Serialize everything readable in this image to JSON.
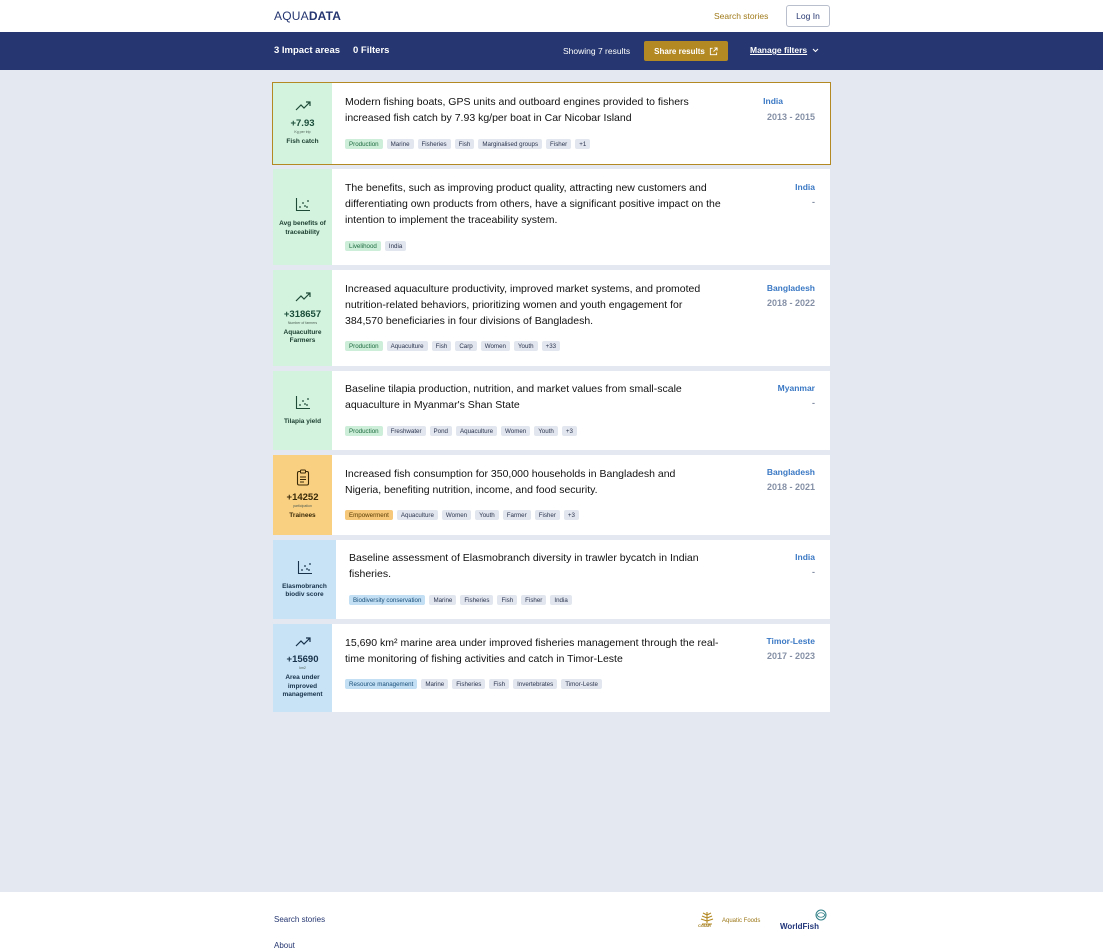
{
  "header": {
    "logo_light": "AQUA",
    "logo_bold": "DATA",
    "search_stories": "Search stories",
    "login": "Log In"
  },
  "filterbar": {
    "impact_areas": "3 Impact areas",
    "filters": "0 Filters",
    "showing": "Showing 7 results",
    "share": "Share results",
    "manage": "Manage filters"
  },
  "cards": [
    {
      "icon": "trend-up-icon",
      "metric_value": "+7.93",
      "metric_unit": "Kg per trip",
      "metric_label": "Fish catch",
      "title": "Modern fishing boats, GPS units and outboard engines provided to fishers increased fish catch by 7.93 kg/per boat in Car Nicobar Island",
      "tags": [
        "Production",
        "Marine",
        "Fisheries",
        "Fish",
        "Marginalised groups",
        "Fisher",
        "+1"
      ],
      "country": "India",
      "years": "2013 - 2015"
    },
    {
      "icon": "scatter-chart-icon",
      "metric_value": "",
      "metric_unit": "",
      "metric_label": "Avg benefits of traceability",
      "title": "The benefits, such as improving product quality, attracting new customers and differentiating own products from others, have a significant positive impact on the intention to implement the traceability system.",
      "tags": [
        "Livelihood",
        "India"
      ],
      "country": "India",
      "years": "-"
    },
    {
      "icon": "trend-up-icon",
      "metric_value": "+318657",
      "metric_unit": "Number of farmers",
      "metric_label": "Aquaculture Farmers",
      "title": "Increased aquaculture productivity, improved market systems, and promoted nutrition-related behaviors, prioritizing women and youth engagement for 384,570 beneficiaries in four divisions of Bangladesh.",
      "tags": [
        "Production",
        "Aquaculture",
        "Fish",
        "Carp",
        "Women",
        "Youth",
        "+33"
      ],
      "country": "Bangladesh",
      "years": "2018 - 2022"
    },
    {
      "icon": "scatter-chart-icon",
      "metric_value": "",
      "metric_unit": "",
      "metric_label": "Tilapia yield",
      "title": "Baseline tilapia production, nutrition, and market values from small-scale aquaculture in Myanmar's Shan State",
      "tags": [
        "Production",
        "Freshwater",
        "Pond",
        "Aquaculture",
        "Women",
        "Youth",
        "+3"
      ],
      "country": "Myanmar",
      "years": "-"
    },
    {
      "icon": "clipboard-icon",
      "metric_value": "+14252",
      "metric_unit": "participation",
      "metric_label": "Trainees",
      "title": "Increased fish consumption for 350,000 households in Bangladesh and Nigeria, benefiting nutrition, income, and food security.",
      "tags": [
        "Empowerment",
        "Aquaculture",
        "Women",
        "Youth",
        "Farmer",
        "Fisher",
        "+3"
      ],
      "country": "Bangladesh",
      "years": "2018 - 2021"
    },
    {
      "icon": "scatter-chart-icon",
      "metric_value": "",
      "metric_unit": "",
      "metric_label": "Elasmobranch biodiv score",
      "title": "Baseline assessment of Elasmobranch diversity in trawler bycatch in Indian fisheries.",
      "tags": [
        "Biodiversity conservation",
        "Marine",
        "Fisheries",
        "Fish",
        "Fisher",
        "India"
      ],
      "country": "India",
      "years": "-"
    },
    {
      "icon": "trend-up-icon",
      "metric_value": "+15690",
      "metric_unit": "km2",
      "metric_label": "Area under improved management",
      "title": "15,690 km² marine area under improved fisheries management through the real-time monitoring of fishing activities and catch in Timor-Leste",
      "tags": [
        "Resource management",
        "Marine",
        "Fisheries",
        "Fish",
        "Invertebrates",
        "Timor-Leste"
      ],
      "country": "Timor-Leste",
      "years": "2017 - 2023"
    }
  ],
  "footer": {
    "search_stories": "Search stories",
    "about": "About",
    "cgiar_small": "CGIAR",
    "cgiar_name": "Aquatic Foods",
    "worldfish": "WorldFish"
  },
  "colors": {
    "navy": "#253670",
    "gold": "#b38924",
    "green_panel": "#d3f3de",
    "orange_panel": "#f9cf82",
    "blue_panel": "#c8e3f5",
    "link_blue": "#3a78c4"
  }
}
